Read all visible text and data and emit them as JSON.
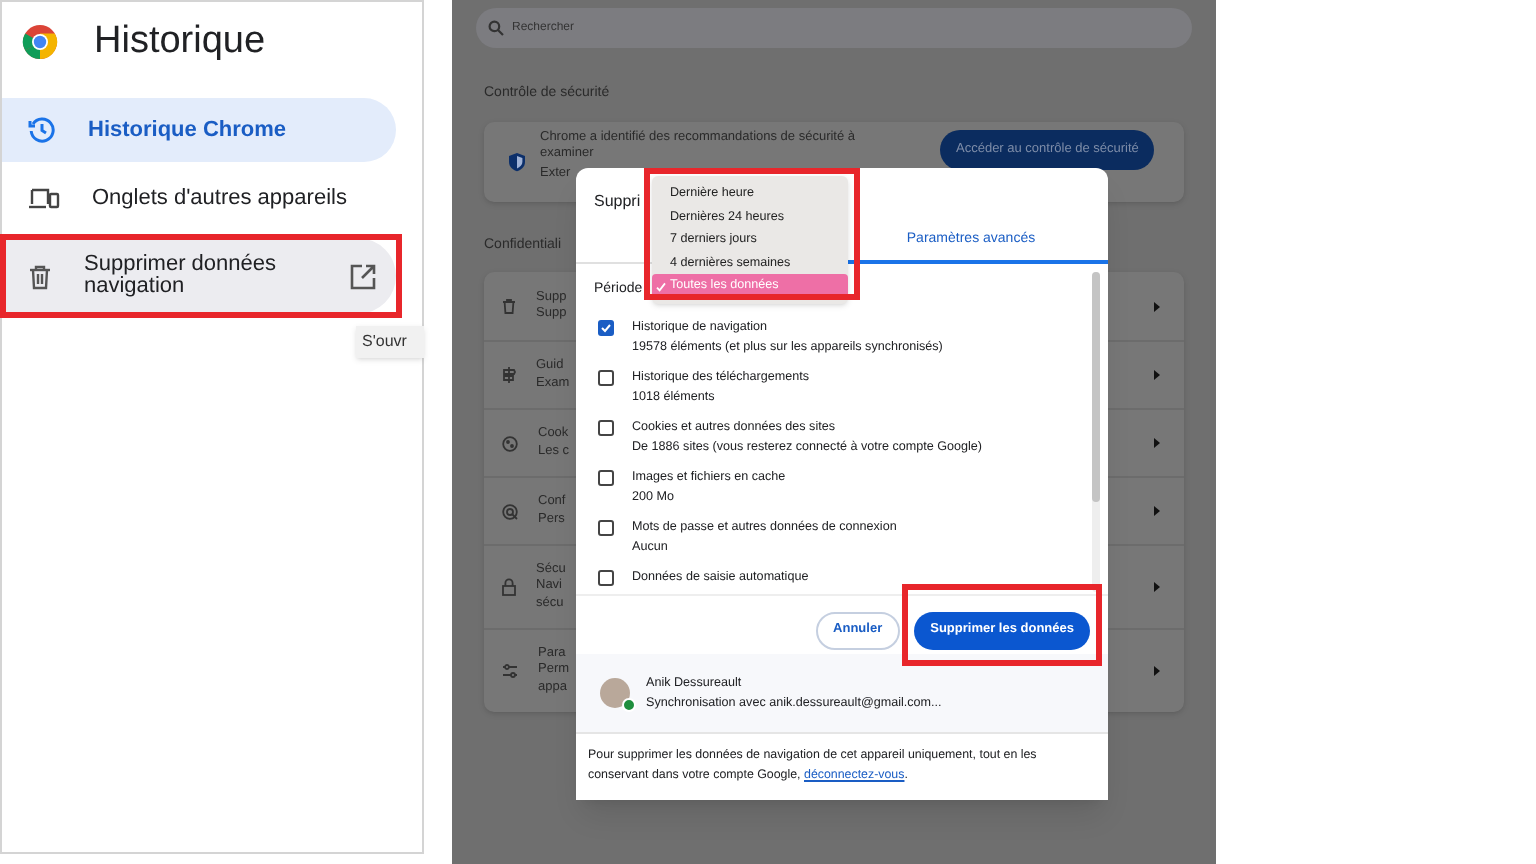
{
  "sidebar": {
    "title": "Historique",
    "items": [
      {
        "label": "Historique Chrome",
        "selected": true,
        "highlighted": false,
        "external": false
      },
      {
        "label": "Onglets d'autres appareils",
        "selected": false,
        "highlighted": false,
        "external": false
      },
      {
        "label": "Supprimer données navigation",
        "selected": false,
        "highlighted": true,
        "external": true
      }
    ],
    "tooltip": "S'ouvr"
  },
  "settings": {
    "search": {
      "placeholder": "Rechercher"
    },
    "safety_heading": "Contrôle de sécurité",
    "safety_card": {
      "lines": [
        "Chrome a identifié des recommandations de sécurité à",
        "examiner"
      ],
      "fragment": "Exter",
      "button": "Accéder au contrôle de sécurité"
    },
    "privacy_heading": "Confidentiali",
    "rows": [
      {
        "lines": [
          "Supp",
          "Supp"
        ]
      },
      {
        "lines": [
          "Guid",
          "Exam"
        ]
      },
      {
        "lines": [
          "Cook",
          "Les c"
        ]
      },
      {
        "lines": [
          "Conf",
          "Pers"
        ]
      },
      {
        "lines": [
          "Sécu",
          "Navi",
          "sécu"
        ]
      },
      {
        "lines": [
          "Para",
          "Perm",
          "appa"
        ]
      }
    ]
  },
  "dialog": {
    "title": "Suppri",
    "tabs": [
      {
        "label": "Paramètres avancés",
        "selected": true
      }
    ],
    "period_label": "Période",
    "period_menu": {
      "highlighted": true,
      "options": [
        {
          "label": "Dernière heure",
          "selected": false
        },
        {
          "label": "Dernières 24 heures",
          "selected": false
        },
        {
          "label": "7 derniers jours",
          "selected": false
        },
        {
          "label": "4 dernières semaines",
          "selected": false
        },
        {
          "label": "Toutes les données",
          "selected": true
        }
      ]
    },
    "items": [
      {
        "title": "Historique de navigation",
        "detail": "19578 éléments (et plus sur les appareils synchronisés)",
        "checked": true
      },
      {
        "title": "Historique des téléchargements",
        "detail": "1018 éléments",
        "checked": false
      },
      {
        "title": "Cookies et autres données des sites",
        "detail": "De 1886 sites (vous resterez connecté à votre compte Google)",
        "checked": false
      },
      {
        "title": "Images et fichiers en cache",
        "detail": "200 Mo",
        "checked": false
      },
      {
        "title": "Mots de passe et autres données de connexion",
        "detail": "Aucun",
        "checked": false
      },
      {
        "title": "Données de saisie automatique",
        "checked": false
      }
    ],
    "buttons": [
      {
        "label": "Annuler",
        "kind": "secondary",
        "highlighted": false
      },
      {
        "label": "Supprimer les données",
        "kind": "primary",
        "highlighted": true
      }
    ],
    "account": {
      "name": "Anik Dessureault",
      "sync": "Synchronisation avec anik.dessureault@gmail.com..."
    },
    "footer": {
      "text": "Pour supprimer les données de navigation de cet appareil uniquement, tout en les conservant dans votre compte Google, ",
      "link": "déconnectez-vous",
      "end": "."
    }
  }
}
